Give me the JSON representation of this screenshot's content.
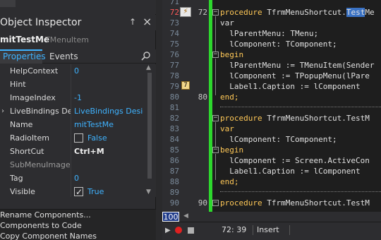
{
  "inspector": {
    "title": "Object Inspector",
    "pin_icon": "pin-icon",
    "close_icon": "close-icon",
    "object_name": "mitTestMe",
    "object_type": "TMenuItem",
    "tabs": [
      {
        "label": "Properties",
        "active": true
      },
      {
        "label": "Events",
        "active": false
      }
    ],
    "properties": [
      {
        "name": "HelpContext",
        "value": "0"
      },
      {
        "name": "Hint",
        "value": ""
      },
      {
        "name": "ImageIndex",
        "value": "-1"
      },
      {
        "name": "LiveBindings Designer",
        "value": "LiveBindings Designer",
        "expander": "›"
      },
      {
        "name": "Name",
        "value": "mitTestMe"
      },
      {
        "name": "RadioItem",
        "value": "False",
        "checkbox": false
      },
      {
        "name": "ShortCut",
        "value": "Ctrl+M",
        "bold": true
      },
      {
        "name": "SubMenuImages",
        "value": "",
        "dim": true
      },
      {
        "name": "Tag",
        "value": "0"
      },
      {
        "name": "Visible",
        "value": "True",
        "checkbox": true
      }
    ],
    "actions": [
      "Rename Components...",
      "Components to Code",
      "Copy Component Names"
    ]
  },
  "editor": {
    "lines": [
      {
        "num": "71",
        "code": ""
      },
      {
        "num": "72",
        "code": "procedure TfrmMenuShortcut.TestMe",
        "current": true,
        "dim": "72"
      },
      {
        "num": "73",
        "code": "var"
      },
      {
        "num": "74",
        "code": "  lParentMenu: TMenu;"
      },
      {
        "num": "75",
        "code": "  lComponent: TComponent;"
      },
      {
        "num": "76",
        "code": "begin"
      },
      {
        "num": "77",
        "code": "  lParentMenu := TMenuItem(Sender"
      },
      {
        "num": "78",
        "code": "  lComponent := TPopupMenu(lPare"
      },
      {
        "num": "79",
        "code": "  Label1.Caption := lComponent"
      },
      {
        "num": "80",
        "code": "end;",
        "dim": "80"
      },
      {
        "num": "81",
        "code": ""
      },
      {
        "num": "82",
        "code": "procedure TfrmMenuShortcut.TestM"
      },
      {
        "num": "83",
        "code": "var"
      },
      {
        "num": "84",
        "code": "  lComponent: TComponent;"
      },
      {
        "num": "85",
        "code": "begin"
      },
      {
        "num": "86",
        "code": "  lComponent := Screen.ActiveCon"
      },
      {
        "num": "87",
        "code": "  Label1.Caption := lComponent"
      },
      {
        "num": "88",
        "code": "end;"
      },
      {
        "num": "89",
        "code": ""
      },
      {
        "num": "90",
        "code": "procedure TfrmMenuShortcut.TestM",
        "dim": "90"
      }
    ],
    "breakpoint_glyph": "⚡",
    "bookmark": "7",
    "selected_word": "Test",
    "zoom": "100",
    "status": {
      "position": "72: 39",
      "mode": "Insert"
    }
  }
}
